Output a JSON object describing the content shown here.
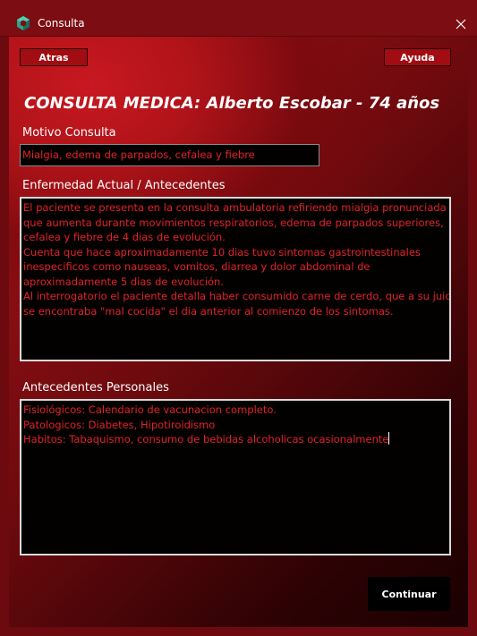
{
  "window": {
    "title": "Consulta",
    "icon": "app-logo-icon",
    "close_icon": "close-icon"
  },
  "toolbar": {
    "back_label": "Atras",
    "help_label": "Ayuda"
  },
  "heading": "CONSULTA MEDICA: Alberto Escobar - 74 años",
  "motivo": {
    "label": "Motivo Consulta",
    "value": "Mialgia, edema de parpados, cefalea y fiebre"
  },
  "enfermedad": {
    "label": "Enfermedad Actual / Antecedentes",
    "lines": [
      "El paciente se presenta en la consulta ambulatoria refiriendo mialgia pronunciada",
      "que aumenta durante movimientos respiratorios, edema de parpados superiores,",
      "cefalea y fiebre de 4 dias de evolución.",
      "Cuenta que hace aproximadamente 10 dias tuvo sintomas gastrointestinales",
      "inespecificos como nauseas, vomitos, diarrea y dolor abdominal de",
      "aproximadamente 5 dias de evolución.",
      "Al interrogatorio el paciente detalla haber consumido carne de cerdo, que a su juicio",
      "se encontraba \"mal cocida\" el dia anterior al comienzo de los sintomas."
    ]
  },
  "antecedentes": {
    "label": "Antecedentes Personales",
    "lines": [
      "Fisiológicos: Calendario de vacunacion completo.",
      "Patologicos: Diabetes, Hipotiroidismo",
      "Habitos: Tabaquismo, consumo de bebidas alcoholicas ocasionalmente"
    ]
  },
  "footer": {
    "continue_label": "Continuar"
  },
  "colors": {
    "frame": "#7c0d12",
    "field_text": "#e0232a",
    "field_bg": "#030000",
    "button_bg": "#a10d12"
  }
}
